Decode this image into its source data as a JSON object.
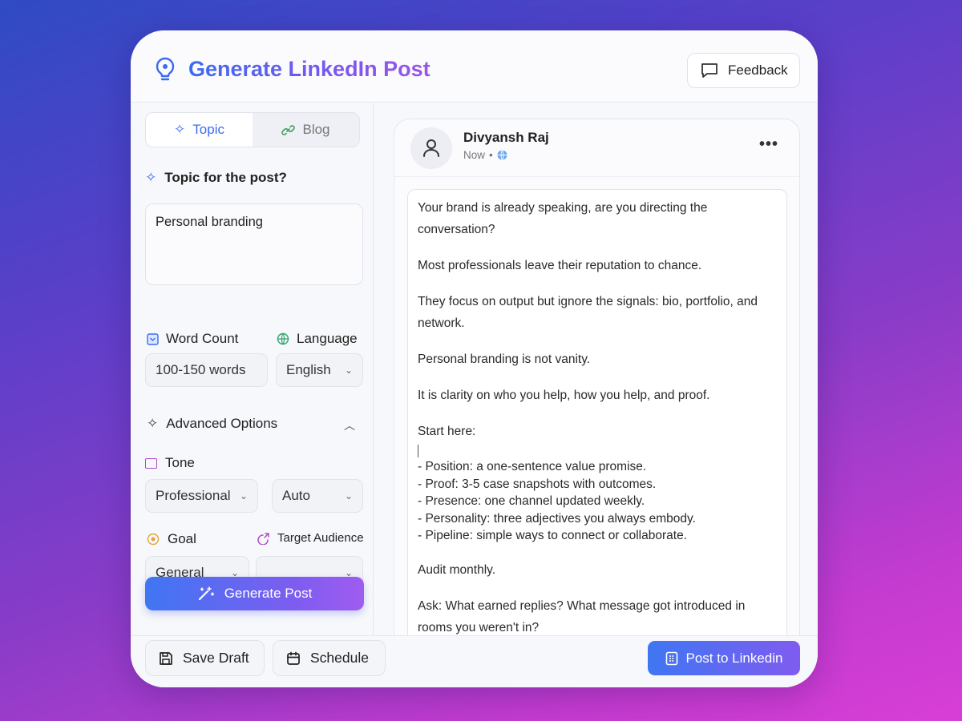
{
  "header": {
    "title": "Generate LinkedIn Post",
    "feedback_label": "Feedback"
  },
  "tabs": [
    {
      "label": "Topic",
      "icon": "sparkle-icon"
    },
    {
      "label": "Blog",
      "icon": "link-icon"
    }
  ],
  "topic": {
    "label": "Topic for the post?",
    "value": "Personal branding"
  },
  "word_count": {
    "label": "Word Count",
    "value": "100-150 words"
  },
  "language": {
    "label": "Language",
    "value": "English"
  },
  "advanced": {
    "label": "Advanced Options"
  },
  "tone": {
    "label": "Tone",
    "value": "Professional",
    "secondary_value": "Auto"
  },
  "goal": {
    "label": "Goal",
    "value": "General"
  },
  "audience": {
    "label": "Target Audience",
    "value": ""
  },
  "generate_label": "Generate Post",
  "post": {
    "author": "Divyansh Raj",
    "time": "Now",
    "paragraphs": [
      "Your brand is already speaking, are you directing the conversation?",
      "Most professionals leave their reputation to chance.",
      "They focus on output but ignore the signals: bio, portfolio, and network.",
      "Personal branding is not vanity.",
      "It is clarity on who you help, how you help, and proof.",
      "Start here:"
    ],
    "list": [
      "- Position: a one-sentence value promise.",
      "- Proof: 3-5 case snapshots with outcomes.",
      "- Presence: one channel updated weekly.",
      "- Personality: three adjectives you always embody.",
      "- Pipeline: simple ways to connect or collaborate."
    ],
    "closing": [
      "Audit monthly.",
      "Ask: What earned replies? What message got introduced in rooms you weren't in?"
    ]
  },
  "footer": {
    "save_label": "Save Draft",
    "schedule_label": "Schedule",
    "post_label": "Post to Linkedin"
  },
  "colors": {
    "accent": "#3b6cf0",
    "accent2": "#8a5cf0"
  }
}
